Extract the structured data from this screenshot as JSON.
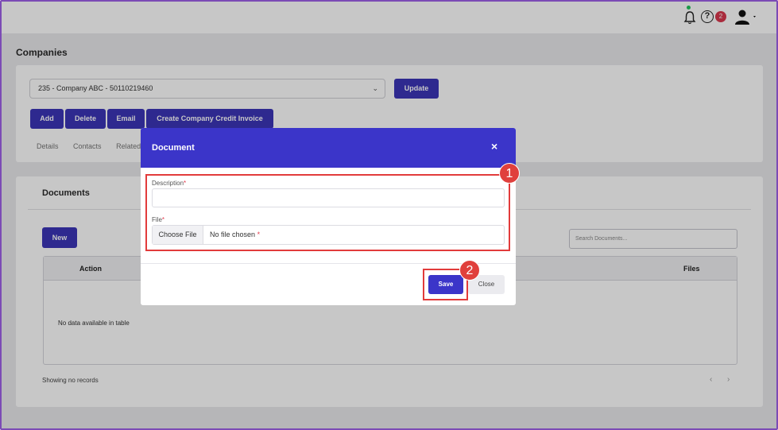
{
  "header": {
    "help_badge_count": "2",
    "status_dot_color": "#22c55e"
  },
  "page": {
    "title": "Companies",
    "company_select": "235 - Company ABC - 50110219460",
    "update_label": "Update",
    "actions": [
      "Add",
      "Delete",
      "Email",
      "Create Company Credit Invoice"
    ],
    "subtabs": [
      "Details",
      "Contacts",
      "Related"
    ]
  },
  "documents": {
    "title": "Documents",
    "new_label": "New",
    "search_placeholder": "Search Documents...",
    "columns": [
      "Action",
      "Files"
    ],
    "empty_text": "No data available in table",
    "showing_text": "Showing no records",
    "prev": "‹",
    "next": "›"
  },
  "modal": {
    "title": "Document",
    "close_icon": "×",
    "description_label": "Description",
    "file_label": "File",
    "required_mark": "*",
    "choose_file_label": "Choose File",
    "no_file_text": "No file chosen",
    "save_label": "Save",
    "close_label": "Close"
  },
  "annotations": [
    "1",
    "2"
  ],
  "colors": {
    "primary": "#3b35c9",
    "highlight": "#e23b3b",
    "badge": "#d9384d"
  }
}
